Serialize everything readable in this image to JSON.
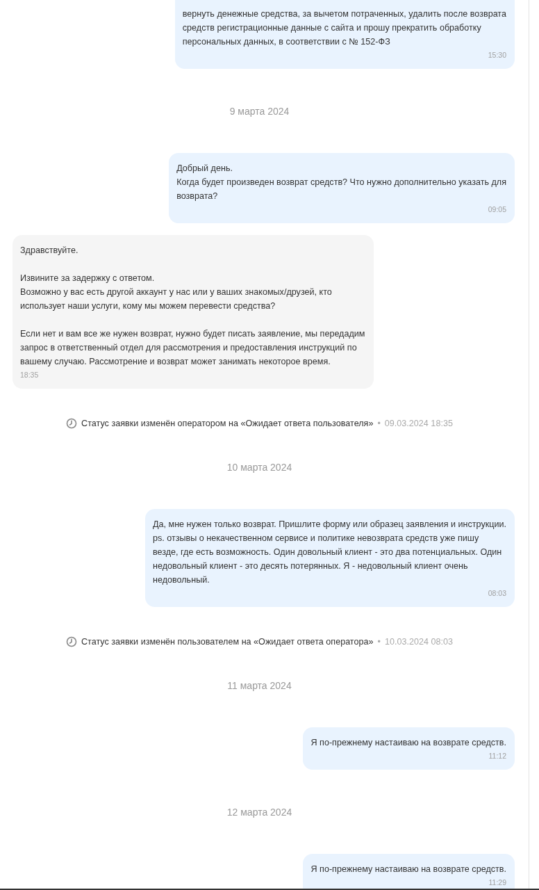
{
  "feed": [
    {
      "kind": "outgoing",
      "paragraphs": [
        [
          "вернуть денежные средства, за вычетом потраченных, удалить после возврата",
          "средств регистрационные данные с сайта и прошу прекратить обработку",
          "персональных данных, в соответствии с № 152-ФЗ"
        ]
      ],
      "time": "15:30"
    },
    {
      "kind": "date",
      "text": "9 марта 2024"
    },
    {
      "kind": "outgoing",
      "paragraphs": [
        [
          "Добрый день.",
          "Когда будет произведен возврат средств? Что нужно дополнительно указать для",
          "возврата?"
        ]
      ],
      "time": "09:05"
    },
    {
      "kind": "incoming",
      "paragraphs": [
        [
          "Здравствуйте."
        ],
        [
          "Извините за задержку с ответом.",
          "Возможно у вас есть другой аккаунт у нас или у ваших знакомых/друзей, кто",
          "использует наши услуги, кому мы можем перевести средства?"
        ],
        [
          "Если нет и вам все же нужен возврат, нужно будет писать заявление, мы передадим",
          "запрос в ответственный отдел для рассмотрения и предоставления инструкций по",
          "вашему случаю. Рассмотрение и возврат может занимать некоторое время."
        ]
      ],
      "time": "18:35"
    },
    {
      "kind": "status",
      "text": "Статус заявки изменён оператором на «Ожидает ответа пользователя»",
      "bullet": "•",
      "stamp": "09.03.2024 18:35"
    },
    {
      "kind": "date",
      "text": "10 марта 2024"
    },
    {
      "kind": "outgoing",
      "paragraphs": [
        [
          "Да, мне нужен только возврат. Пришлите форму или образец заявления и инструкции.",
          "ps. отзывы о некачественном сервисе и политике невозврата средств уже пишу",
          "везде, где есть возможность. Один довольный клиент - это два потенциальных. Один",
          "недовольный клиент - это десять потерянных. Я - недовольный клиент очень",
          "недовольный."
        ]
      ],
      "time": "08:03"
    },
    {
      "kind": "status",
      "text": "Статус заявки изменён пользователем на «Ожидает ответа оператора»",
      "bullet": "•",
      "stamp": "10.03.2024 08:03"
    },
    {
      "kind": "date",
      "text": "11 марта 2024"
    },
    {
      "kind": "outgoing",
      "paragraphs": [
        [
          "Я по-прежнему настаиваю на возврате средств."
        ]
      ],
      "time": "11:12"
    },
    {
      "kind": "date",
      "text": "12 марта 2024"
    },
    {
      "kind": "outgoing",
      "paragraphs": [
        [
          "Я по-прежнему настаиваю на возврате средств."
        ]
      ],
      "time": "11:29"
    }
  ]
}
